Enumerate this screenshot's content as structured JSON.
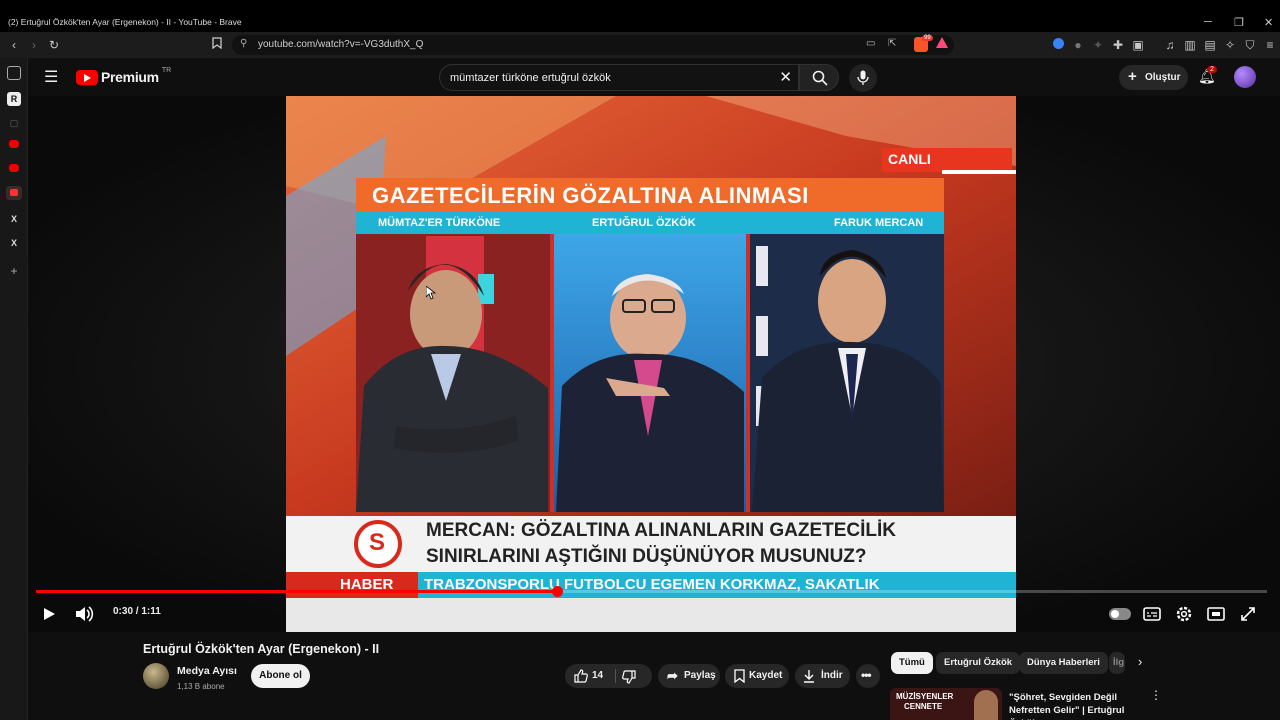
{
  "browser": {
    "tab_title": "(2) Ertuğrul Özkök'ten Ayar (Ergenekon) - II - YouTube - Brave",
    "url": "youtube.com/watch?v=-VG3duthX_Q",
    "brave_badge": "99"
  },
  "masthead": {
    "logo": "Premium",
    "logo_region": "TR",
    "search_value": "mümtazer türköne ertuğrul özkök",
    "create_label": "Oluştur",
    "notification_count": "2"
  },
  "video": {
    "channel_bug": "CANLI",
    "headline": "GAZETECİLERİN GÖZALTINA ALINMASI",
    "guests": [
      "MÜMTAZ'ER TÜRKÖNE",
      "ERTUĞRUL ÖZKÖK",
      "FARUK MERCAN"
    ],
    "lower_third_line1": "MERCAN: GÖZALTINA ALINANLARIN GAZETECİLİK",
    "lower_third_line2": "SINIRLARINI AŞTIĞINI DÜŞÜNÜYOR MUSUNUZ?",
    "network_logo": "S",
    "ticker_label": "HABER",
    "ticker_text": "TRABZONSPORLU FUTBOLCU EGEMEN KORKMAZ, SAKATLIK",
    "progress_fraction": 0.4233
  },
  "controls": {
    "time": "0:30 / 1:11"
  },
  "details": {
    "title": "Ertuğrul Özkök'ten Ayar (Ergenekon) - II",
    "channel_name": "Medya Ayısı",
    "subscribers": "1,13 B abone",
    "subscribe_label": "Abone ol",
    "like_count": "14",
    "share_label": "Paylaş",
    "save_label": "Kaydet",
    "download_label": "İndir"
  },
  "chips": [
    "Tümü",
    "Ertuğrul Özkök",
    "Dünya Haberleri",
    "İlg"
  ],
  "recommendation": {
    "thumb_text_1": "MÜZİSYENLER",
    "thumb_text_2": "CENNETE",
    "title": "\"Şöhret, Sevgiden Değil Nefretten Gelir\" | Ertuğrul Özkök"
  },
  "colors": {
    "accent": "#ff0000",
    "background": "#0f0f0f",
    "headline_bar": "#f06a2a",
    "ticker_cyan": "#1fb3d4"
  }
}
